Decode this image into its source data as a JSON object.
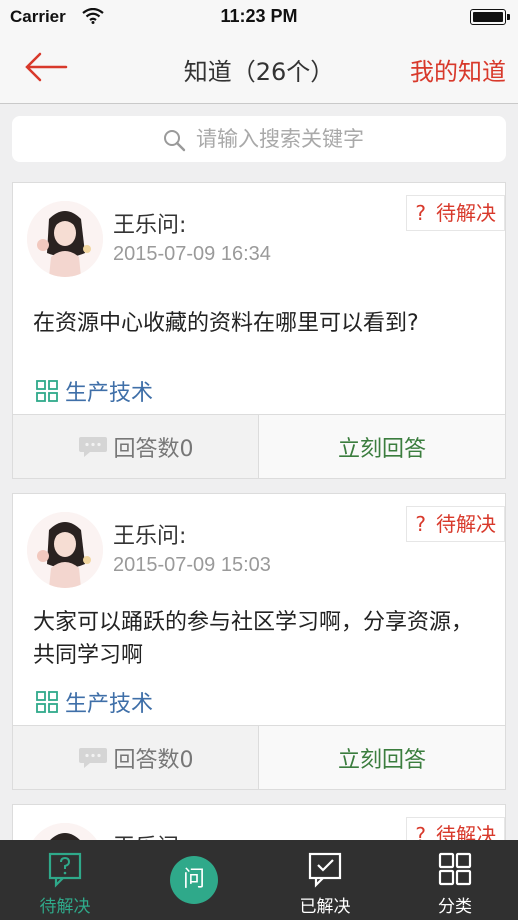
{
  "status_bar": {
    "carrier": "Carrier",
    "time": "11:23 PM"
  },
  "nav": {
    "title": "知道（26个）",
    "right_link": "我的知道"
  },
  "search": {
    "placeholder": "请输入搜索关键字"
  },
  "cards": [
    {
      "asker": "王乐问:",
      "date": "2015-07-09 16:34",
      "status": "待解决",
      "status_mark": "?",
      "question": "在资源中心收藏的资料在哪里可以看到?",
      "category": "生产技术",
      "answer_count": "回答数0",
      "answer_action": "立刻回答"
    },
    {
      "asker": "王乐问:",
      "date": "2015-07-09 15:03",
      "status": "待解决",
      "status_mark": "?",
      "question": "大家可以踊跃的参与社区学习啊，分享资源，共同学习啊",
      "category": "生产技术",
      "answer_count": "回答数0",
      "answer_action": "立刻回答"
    },
    {
      "asker": "王乐问:",
      "status": "待解决",
      "status_mark": "?"
    }
  ],
  "tabbar": {
    "tab_pending": "待解决",
    "fab_label": "问",
    "tab_solved": "已解决",
    "tab_category": "分类"
  },
  "colors": {
    "accent_red": "#d8392b",
    "accent_green": "#2fa98a",
    "link_blue": "#3f6fa8",
    "tabbar_bg": "#303030"
  }
}
